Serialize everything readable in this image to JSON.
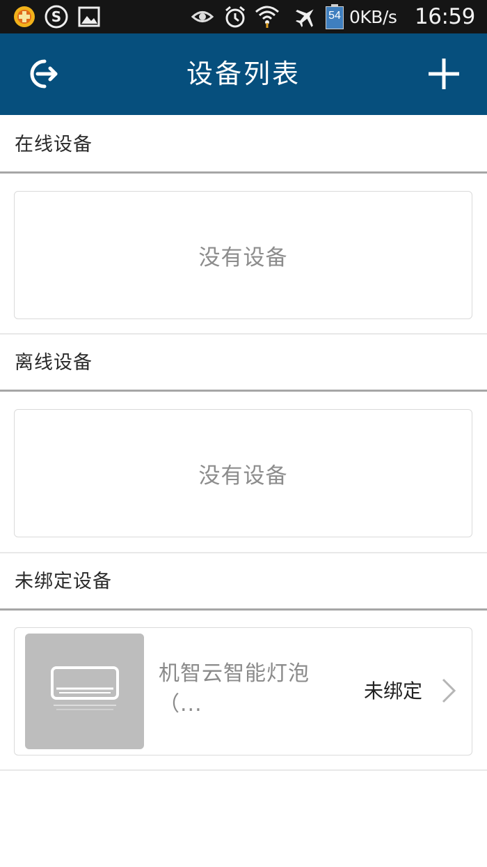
{
  "status_bar": {
    "icons": [
      "game-app-icon",
      "sogou-input-icon",
      "gallery-icon",
      "eye-icon",
      "alarm-icon",
      "wifi-icon",
      "airplane-mode-icon",
      "battery-icon"
    ],
    "battery_level": "54",
    "net_speed": "0KB/s",
    "time": "16:59"
  },
  "header": {
    "title": "设备列表",
    "back_icon": "logout-icon",
    "add_icon": "plus-icon"
  },
  "sections": {
    "online": {
      "title": "在线设备",
      "empty_text": "没有设备"
    },
    "offline": {
      "title": "离线设备",
      "empty_text": "没有设备"
    },
    "unbound": {
      "title": "未绑定设备",
      "devices": [
        {
          "name": "机智云智能灯泡（...",
          "status": "未绑定",
          "icon": "air-conditioner-icon"
        }
      ]
    }
  },
  "colors": {
    "header_bg": "#064f7d",
    "status_bar_bg": "#151515",
    "thumb_bg": "#bdbdbd"
  }
}
